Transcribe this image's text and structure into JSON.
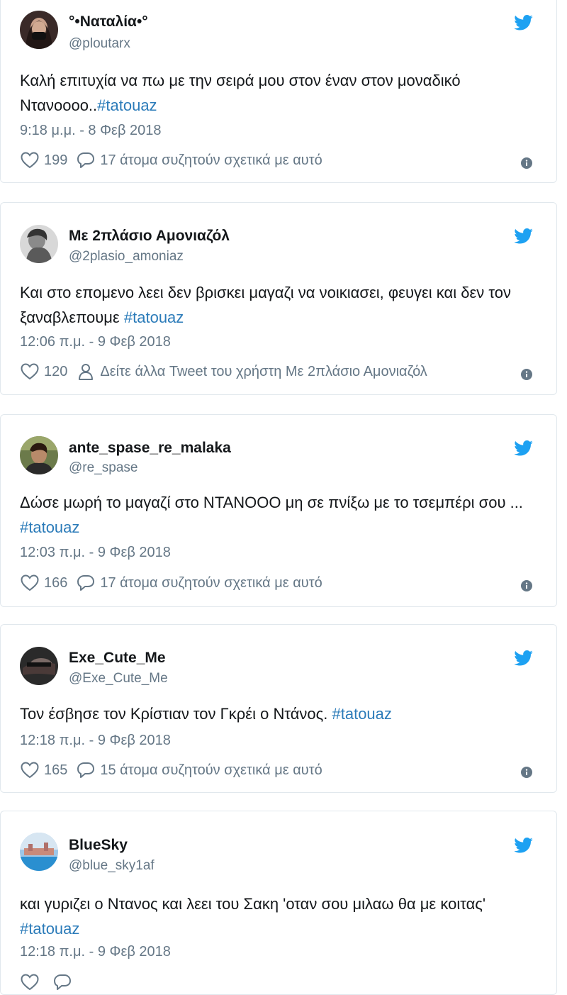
{
  "tweets": [
    {
      "name": "°•Ναταλία•°",
      "handle": "@ploutarx",
      "text_before": "Καλή επιτυχία να πω με την σειρά μου στον έναν στον μοναδικό Ντανοοοο..",
      "hashtag": "#tatouaz",
      "time": "9:18 μ.μ. - 8 Φεβ 2018",
      "likes": "199",
      "action_text": "17 άτομα συζητούν σχετικά με αυτό",
      "action_icon": "reply-icon"
    },
    {
      "name": "Με 2πλάσιο Αμονιαζόλ",
      "handle": "@2plasio_amoniaz",
      "text_before": "Και στο επομενο λεει δεν βρισκει μαγαζι να νοικιασει, φευγει και δεν τον ξαναβλεπουμε ",
      "hashtag": "#tatouaz",
      "time": "12:06 π.μ. - 9 Φεβ 2018",
      "likes": "120",
      "action_text": "Δείτε άλλα Tweet του χρήστη Με 2πλάσιο Αμονιαζόλ",
      "action_icon": "user-icon"
    },
    {
      "name": "ante_spase_re_malaka",
      "handle": "@re_spase",
      "text_before": "Δώσε μωρή το μαγαζί στο ΝΤΑΝΟΟΟ μη σε πνίξω με το τσεμπέρι σου ... ",
      "hashtag": "#tatouaz",
      "time": "12:03 π.μ. - 9 Φεβ 2018",
      "likes": "166",
      "action_text": "17 άτομα συζητούν σχετικά με αυτό",
      "action_icon": "reply-icon"
    },
    {
      "name": "Exe_Cute_Me",
      "handle": "@Exe_Cute_Me",
      "text_before": "Τον έσβησε τον Κρίστιαν τον Γκρέι ο Ντάνος. ",
      "hashtag": "#tatouaz",
      "time": "12:18 π.μ. - 9 Φεβ 2018",
      "likes": "165",
      "action_text": "15 άτομα συζητούν σχετικά με αυτό",
      "action_icon": "reply-icon"
    },
    {
      "name": "BlueSky",
      "handle": "@blue_sky1af",
      "text_before": "και γυριζει ο Ντανος και λεει του Σακη 'οταν σου μιλαω θα με κοιτας' ",
      "hashtag": "#tatouaz",
      "time": "12:18 π.μ. - 9 Φεβ 2018",
      "likes": "",
      "action_text": "",
      "action_icon": "reply-icon"
    }
  ],
  "colors": {
    "twitter_blue": "#1da1f2",
    "hashtag": "#2b7bb9",
    "secondary_text": "#657786",
    "border": "#e1e8ed"
  }
}
